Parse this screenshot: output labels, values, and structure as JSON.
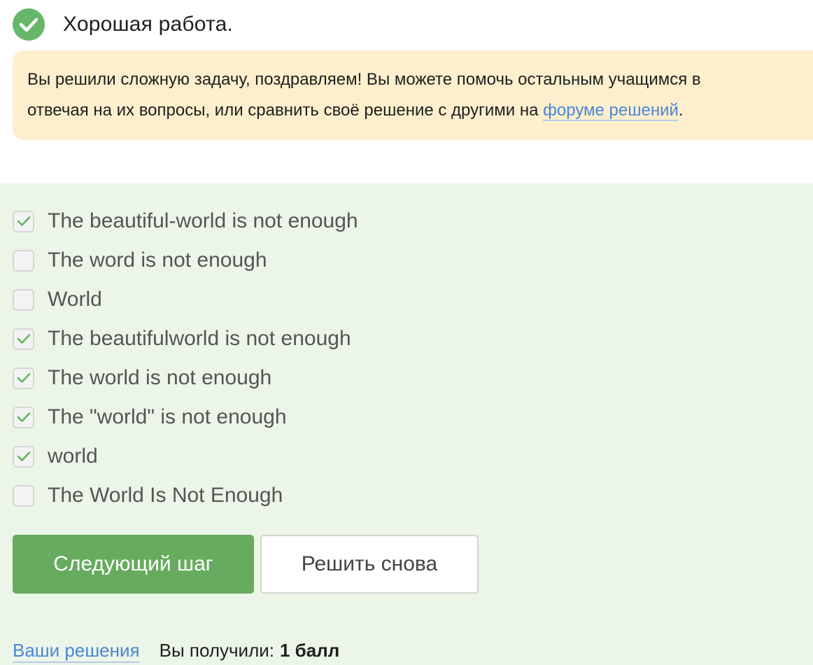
{
  "status": {
    "title": "Хорошая работа.",
    "icon": "check-circle-icon",
    "color": "#66b76a"
  },
  "notice": {
    "line1": "Вы решили сложную задачу, поздравляем! Вы можете помочь остальным учащимся в",
    "line2_prefix": "отвечая на их вопросы, или сравнить своё решение с другими на ",
    "forum_link": "форуме решений",
    "line2_suffix": ".",
    "background": "#fdefcd"
  },
  "quiz": {
    "options": [
      {
        "label": "The beautiful-world is not enough",
        "checked": true
      },
      {
        "label": "The word is not enough",
        "checked": false
      },
      {
        "label": "World",
        "checked": false
      },
      {
        "label": "The beautifulworld is not enough",
        "checked": true
      },
      {
        "label": "The world is not enough",
        "checked": true
      },
      {
        "label": "The \"world\" is not enough",
        "checked": true
      },
      {
        "label": "world",
        "checked": true
      },
      {
        "label": "The World Is Not Enough",
        "checked": false
      }
    ],
    "next_button": "Следующий шаг",
    "retry_button": "Решить снова",
    "background": "#ebf5e8",
    "accent": "#67ab5f"
  },
  "footer": {
    "solutions_link": "Ваши решения",
    "score_label": "Вы получили:",
    "score_value": "1 балл"
  }
}
